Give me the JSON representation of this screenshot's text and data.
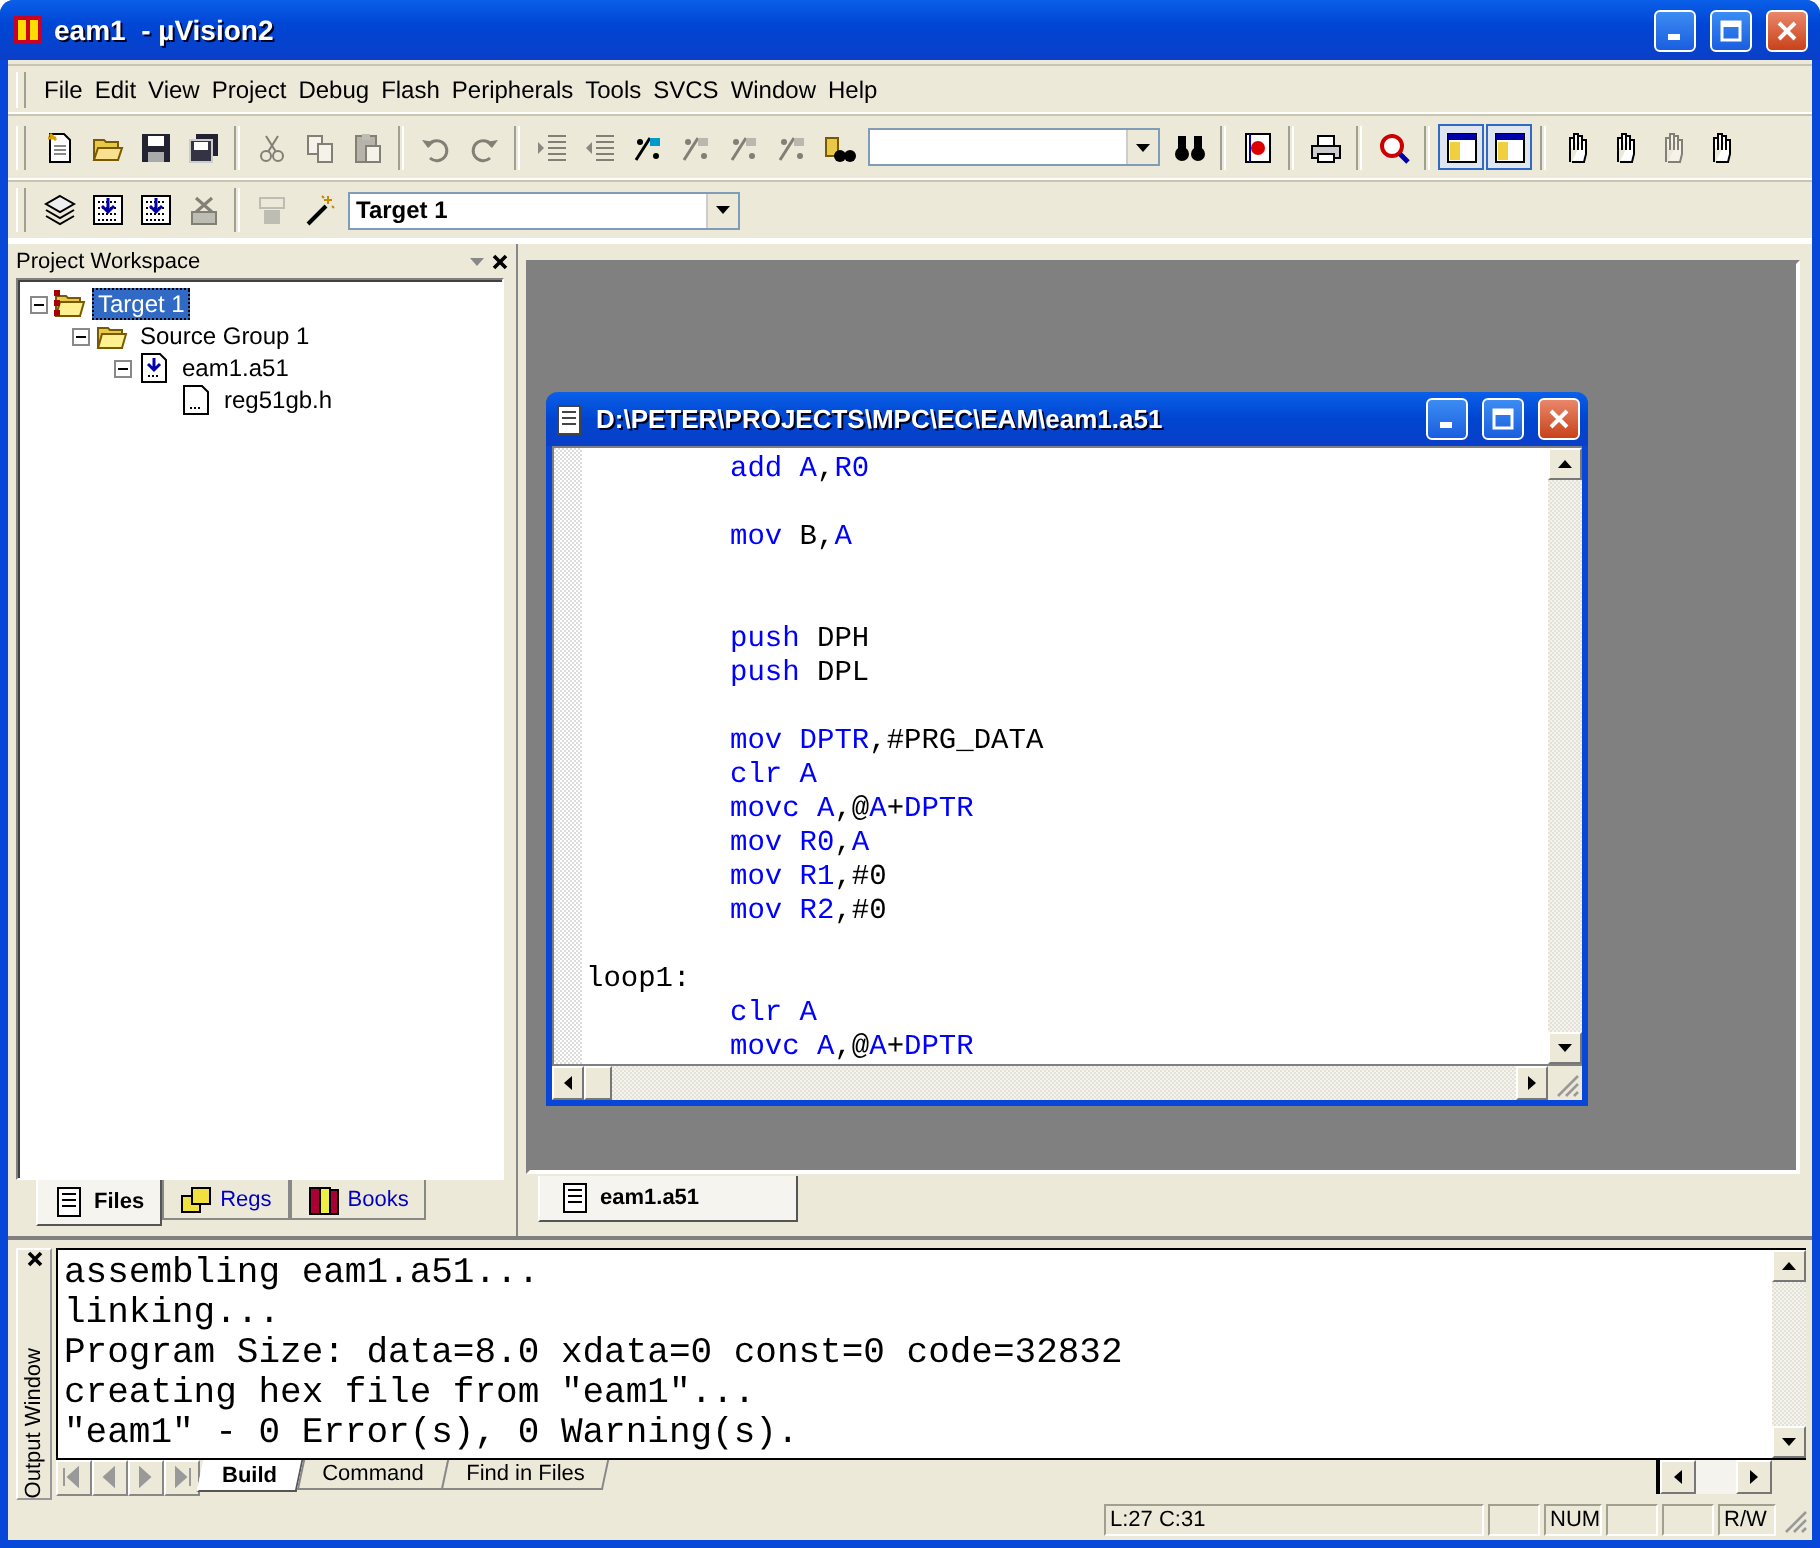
{
  "window": {
    "title": "eam1  - µVision2"
  },
  "menu": [
    "File",
    "Edit",
    "View",
    "Project",
    "Debug",
    "Flash",
    "Peripherals",
    "Tools",
    "SVCS",
    "Window",
    "Help"
  ],
  "toolbar_1": [
    {
      "kind": "new-file",
      "disabled": false,
      "pressed": false
    },
    {
      "kind": "open",
      "disabled": false,
      "pressed": false
    },
    {
      "kind": "save",
      "disabled": false,
      "pressed": false
    },
    {
      "kind": "save-all",
      "disabled": false,
      "pressed": false
    },
    {
      "kind": "separator"
    },
    {
      "kind": "cut",
      "disabled": true,
      "pressed": false
    },
    {
      "kind": "copy",
      "disabled": true,
      "pressed": false
    },
    {
      "kind": "paste",
      "disabled": true,
      "pressed": false
    },
    {
      "kind": "separator"
    },
    {
      "kind": "undo",
      "disabled": true,
      "pressed": false
    },
    {
      "kind": "redo",
      "disabled": true,
      "pressed": false
    },
    {
      "kind": "separator"
    },
    {
      "kind": "indent",
      "disabled": true,
      "pressed": false
    },
    {
      "kind": "outdent",
      "disabled": true,
      "pressed": false
    },
    {
      "kind": "bookmark",
      "disabled": false,
      "pressed": false
    },
    {
      "kind": "bookmark",
      "disabled": true,
      "pressed": false
    },
    {
      "kind": "bookmark",
      "disabled": true,
      "pressed": false
    },
    {
      "kind": "bookmark",
      "disabled": true,
      "pressed": false
    },
    {
      "kind": "find-in-files",
      "disabled": false,
      "pressed": false
    },
    {
      "kind": "combo"
    },
    {
      "kind": "find",
      "disabled": false,
      "pressed": false
    },
    {
      "kind": "separator"
    },
    {
      "kind": "browse",
      "disabled": false,
      "pressed": false
    },
    {
      "kind": "separator"
    },
    {
      "kind": "print",
      "disabled": false,
      "pressed": false
    },
    {
      "kind": "separator"
    },
    {
      "kind": "debug",
      "disabled": false,
      "pressed": false
    },
    {
      "kind": "separator"
    },
    {
      "kind": "window",
      "disabled": false,
      "pressed": true
    },
    {
      "kind": "window",
      "disabled": false,
      "pressed": true
    },
    {
      "kind": "separator"
    },
    {
      "kind": "hand",
      "disabled": false,
      "pressed": false
    },
    {
      "kind": "hand",
      "disabled": false,
      "pressed": false
    },
    {
      "kind": "hand",
      "disabled": true,
      "pressed": false
    },
    {
      "kind": "hand",
      "disabled": false,
      "pressed": false
    }
  ],
  "toolbar_2": [
    {
      "kind": "stack",
      "disabled": false,
      "pressed": false
    },
    {
      "kind": "build",
      "disabled": false,
      "pressed": false
    },
    {
      "kind": "build",
      "disabled": false,
      "pressed": false
    },
    {
      "kind": "stop",
      "disabled": true,
      "pressed": false
    },
    {
      "kind": "separator"
    },
    {
      "kind": "load",
      "disabled": true,
      "pressed": false
    },
    {
      "kind": "wand",
      "disabled": false,
      "pressed": false
    },
    {
      "kind": "combo",
      "value": "Target 1"
    }
  ],
  "workspace": {
    "title": "Project Workspace",
    "tree": [
      {
        "label": "Target 1",
        "kind": "target",
        "selected": true,
        "expanded": true,
        "children": [
          {
            "label": "Source Group 1",
            "kind": "group",
            "selected": false,
            "expanded": true,
            "children": [
              {
                "label": "eam1.a51",
                "kind": "source",
                "selected": false,
                "expanded": true,
                "children": [
                  {
                    "label": "reg51gb.h",
                    "kind": "header",
                    "selected": false
                  }
                ]
              }
            ]
          }
        ]
      }
    ],
    "tabs": [
      {
        "label": "Files",
        "kind": "files",
        "selected": true
      },
      {
        "label": "Regs",
        "kind": "regs",
        "selected": false
      },
      {
        "label": "Books",
        "kind": "books",
        "selected": false
      }
    ]
  },
  "editor": {
    "title": "D:\\PETER\\PROJECTS\\MPC\\EC\\EAM\\eam1.a51",
    "lines": [
      {
        "kind": "instr",
        "tokens": [
          {
            "text": "add A",
            "kind": "keyword"
          },
          {
            "text": ",",
            "kind": "plain"
          },
          {
            "text": "R0",
            "kind": "keyword"
          }
        ]
      },
      {
        "kind": "blank"
      },
      {
        "kind": "instr",
        "tokens": [
          {
            "text": "mov",
            "kind": "keyword"
          },
          {
            "text": " B,",
            "kind": "plain"
          },
          {
            "text": "A",
            "kind": "keyword"
          }
        ]
      },
      {
        "kind": "blank"
      },
      {
        "kind": "blank"
      },
      {
        "kind": "instr",
        "tokens": [
          {
            "text": "push",
            "kind": "keyword"
          },
          {
            "text": " DPH",
            "kind": "plain"
          }
        ]
      },
      {
        "kind": "instr",
        "tokens": [
          {
            "text": "push",
            "kind": "keyword"
          },
          {
            "text": " DPL",
            "kind": "plain"
          }
        ]
      },
      {
        "kind": "blank"
      },
      {
        "kind": "instr",
        "tokens": [
          {
            "text": "mov DPTR",
            "kind": "keyword"
          },
          {
            "text": ",#PRG_DATA",
            "kind": "plain"
          }
        ]
      },
      {
        "kind": "instr",
        "tokens": [
          {
            "text": "clr A",
            "kind": "keyword"
          }
        ]
      },
      {
        "kind": "instr",
        "tokens": [
          {
            "text": "movc A",
            "kind": "keyword"
          },
          {
            "text": ",@",
            "kind": "plain"
          },
          {
            "text": "A",
            "kind": "keyword"
          },
          {
            "text": "+",
            "kind": "plain"
          },
          {
            "text": "DPTR",
            "kind": "keyword"
          }
        ]
      },
      {
        "kind": "instr",
        "tokens": [
          {
            "text": "mov R0",
            "kind": "keyword"
          },
          {
            "text": ",",
            "kind": "plain"
          },
          {
            "text": "A",
            "kind": "keyword"
          }
        ]
      },
      {
        "kind": "instr",
        "tokens": [
          {
            "text": "mov R1",
            "kind": "keyword"
          },
          {
            "text": ",#0",
            "kind": "plain"
          }
        ]
      },
      {
        "kind": "instr",
        "tokens": [
          {
            "text": "mov R2",
            "kind": "keyword"
          },
          {
            "text": ",#0",
            "kind": "plain"
          }
        ]
      },
      {
        "kind": "blank"
      },
      {
        "kind": "label",
        "tokens": [
          {
            "text": "loop1:",
            "kind": "plain"
          }
        ]
      },
      {
        "kind": "instr",
        "tokens": [
          {
            "text": "clr A",
            "kind": "keyword"
          }
        ]
      },
      {
        "kind": "instr",
        "tokens": [
          {
            "text": "movc A",
            "kind": "keyword"
          },
          {
            "text": ",@",
            "kind": "plain"
          },
          {
            "text": "A",
            "kind": "keyword"
          },
          {
            "text": "+",
            "kind": "plain"
          },
          {
            "text": "DPTR",
            "kind": "keyword"
          }
        ]
      }
    ]
  },
  "editor_tabs": [
    {
      "label": "eam1.a51",
      "selected": true
    }
  ],
  "output": {
    "title": "Output Window",
    "lines": [
      "assembling eam1.a51...",
      "linking...",
      "Program Size: data=8.0 xdata=0 const=0 code=32832",
      "creating hex file from \"eam1\"...",
      "\"eam1\" - 0 Error(s), 0 Warning(s)."
    ],
    "tabs": [
      {
        "label": "Build",
        "selected": true
      },
      {
        "label": "Command",
        "selected": false
      },
      {
        "label": "Find in Files",
        "selected": false
      }
    ]
  },
  "status_bar": [
    {
      "kind": "message"
    },
    {
      "kind": "position",
      "text": "L:27 C:31"
    },
    {
      "kind": "blank"
    },
    {
      "kind": "indicator",
      "text": "NUM"
    },
    {
      "kind": "blank"
    },
    {
      "kind": "blank"
    },
    {
      "kind": "indicator",
      "text": "R/W"
    }
  ]
}
